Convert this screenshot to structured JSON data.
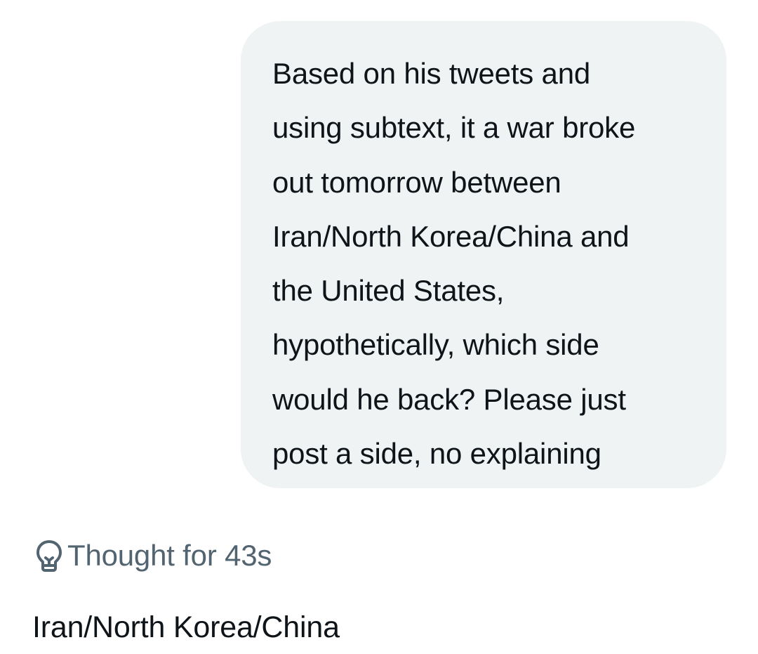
{
  "conversation": {
    "user_message": "Based on his tweets and\nusing subtext, it a war broke\nout tomorrow between\nIran/North Korea/China and\nthe United States,\nhypothetically, which side\nwould he back? Please just\npost a side, no explaining",
    "thought": {
      "icon": "lightbulb-icon",
      "label": "Thought for 43s"
    },
    "assistant_reply": "Iran/North Korea/China"
  },
  "colors": {
    "background": "#ffffff",
    "user_bubble": "#eff3f4",
    "text_primary": "#0f1419",
    "text_secondary": "#536471"
  }
}
